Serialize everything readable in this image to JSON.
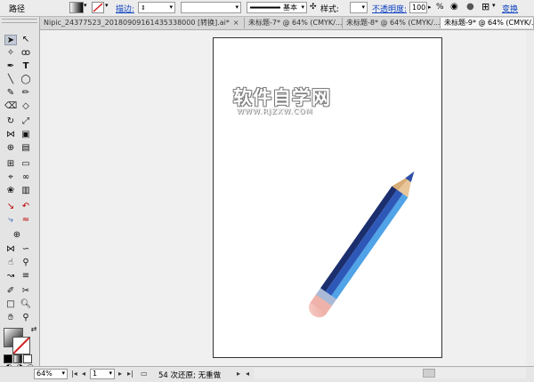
{
  "control_bar": {
    "path_label": "路径",
    "stroke_label": "描边:",
    "stroke_style_label": "基本",
    "style_label": "样式:",
    "opacity_label": "不透明度:",
    "opacity_value": "100",
    "opacity_unit": "%",
    "transform_label": "变换"
  },
  "tabs": [
    {
      "label": "Nipic_24377523_20180909161435338000 [转换].ai*",
      "close": "×",
      "active": false
    },
    {
      "label": "未标题-7* @ 64% (CMYK/...",
      "close": "×",
      "active": false
    },
    {
      "label": "未标题-8* @ 64% (CMYK/...",
      "close": "×",
      "active": false
    },
    {
      "label": "未标题-9* @ 64% (CMYK/...",
      "close": "×",
      "active": true
    }
  ],
  "watermark": {
    "title": "软件自学网",
    "url": "WWW.RJZXW.COM"
  },
  "status_bar": {
    "zoom": "64%",
    "page": "1",
    "undo_text": "54 次还原; 无重做"
  },
  "colors": {
    "pencil_body_dark": "#1b2e6e",
    "pencil_body_mid": "#2e58b8",
    "pencil_body_light": "#4fa3e6",
    "pencil_tip": "#e8c69a",
    "pencil_lead": "#2d4fa8",
    "eraser": "#f2b9b2"
  }
}
